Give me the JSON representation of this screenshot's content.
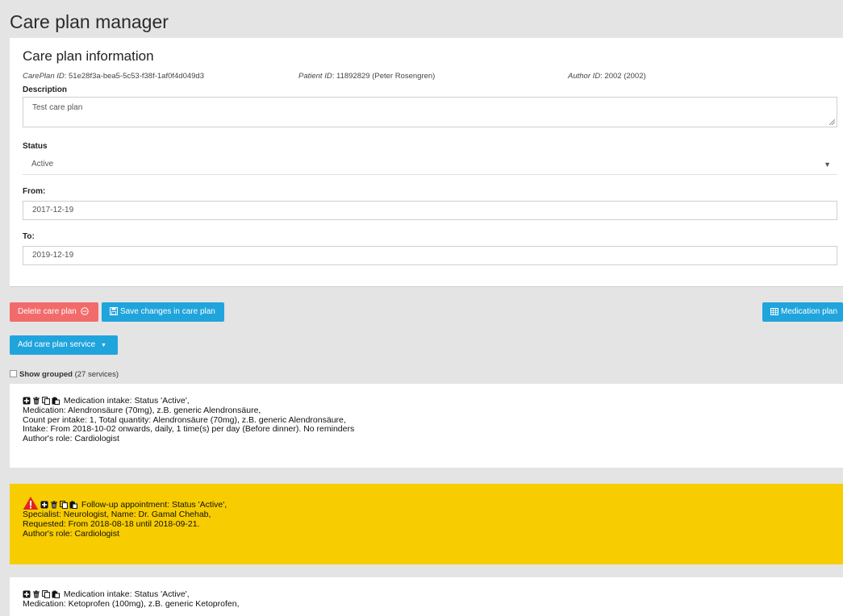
{
  "page": {
    "title": "Care plan manager"
  },
  "info": {
    "title": "Care plan information",
    "careplan_id_label": "CarePlan ID",
    "careplan_id_value": ": 51e28f3a-bea5-5c53-f38f-1af0f4d049d3",
    "patient_id_label": "Patient ID",
    "patient_id_value": ": 11892829 (Peter Rosengren)",
    "author_id_label": "Author ID",
    "author_id_value": ": 2002 (2002)",
    "description_label": "Description",
    "description_value": "Test care plan",
    "status_label": "Status",
    "status_value": "Active",
    "from_label": "From:",
    "from_value": "2017-12-19",
    "to_label": "To:",
    "to_value": "2019-12-19"
  },
  "actions": {
    "delete_label": "Delete care plan",
    "save_label": "Save changes in care plan",
    "medication_plan_label": "Medication plan",
    "add_service_label": "Add care plan service"
  },
  "list": {
    "show_grouped_label": "Show grouped",
    "count_text": "(27 services)"
  },
  "services": [
    {
      "lines": [
        "Medication intake: Status 'Active',",
        "Medication: Alendronsäure (70mg), z.B. generic Alendronsäure,",
        "Count per intake: 1, Total quantity: Alendronsäure (70mg), z.B. generic Alendronsäure,",
        "Intake: From 2018-10-02 onwards, daily, 1 time(s) per day (Before dinner). No reminders",
        "Author's role: Cardiologist"
      ]
    },
    {
      "lines": [
        "Follow-up appointment: Status 'Active',",
        "Specialist: Neurologist, Name: Dr. Gamal Chehab,",
        "Requested: From 2018-08-18 until 2018-09-21.",
        "Author's role: Cardiologist"
      ]
    },
    {
      "lines": [
        "Medication intake: Status 'Active',",
        "Medication: Ketoprofen (100mg), z.B. generic Ketoprofen,"
      ]
    }
  ],
  "colors": {
    "delete": "#f26b6b",
    "primary": "#20a4dc",
    "warning_bg": "#f7cc00",
    "warning_icon": "#e32222"
  },
  "icons": [
    "plus-square-icon",
    "trash-icon",
    "copy-icon",
    "paste-icon",
    "warning-icon",
    "minus-circle-icon",
    "floppy-icon",
    "table-icon",
    "caret-down-icon"
  ]
}
